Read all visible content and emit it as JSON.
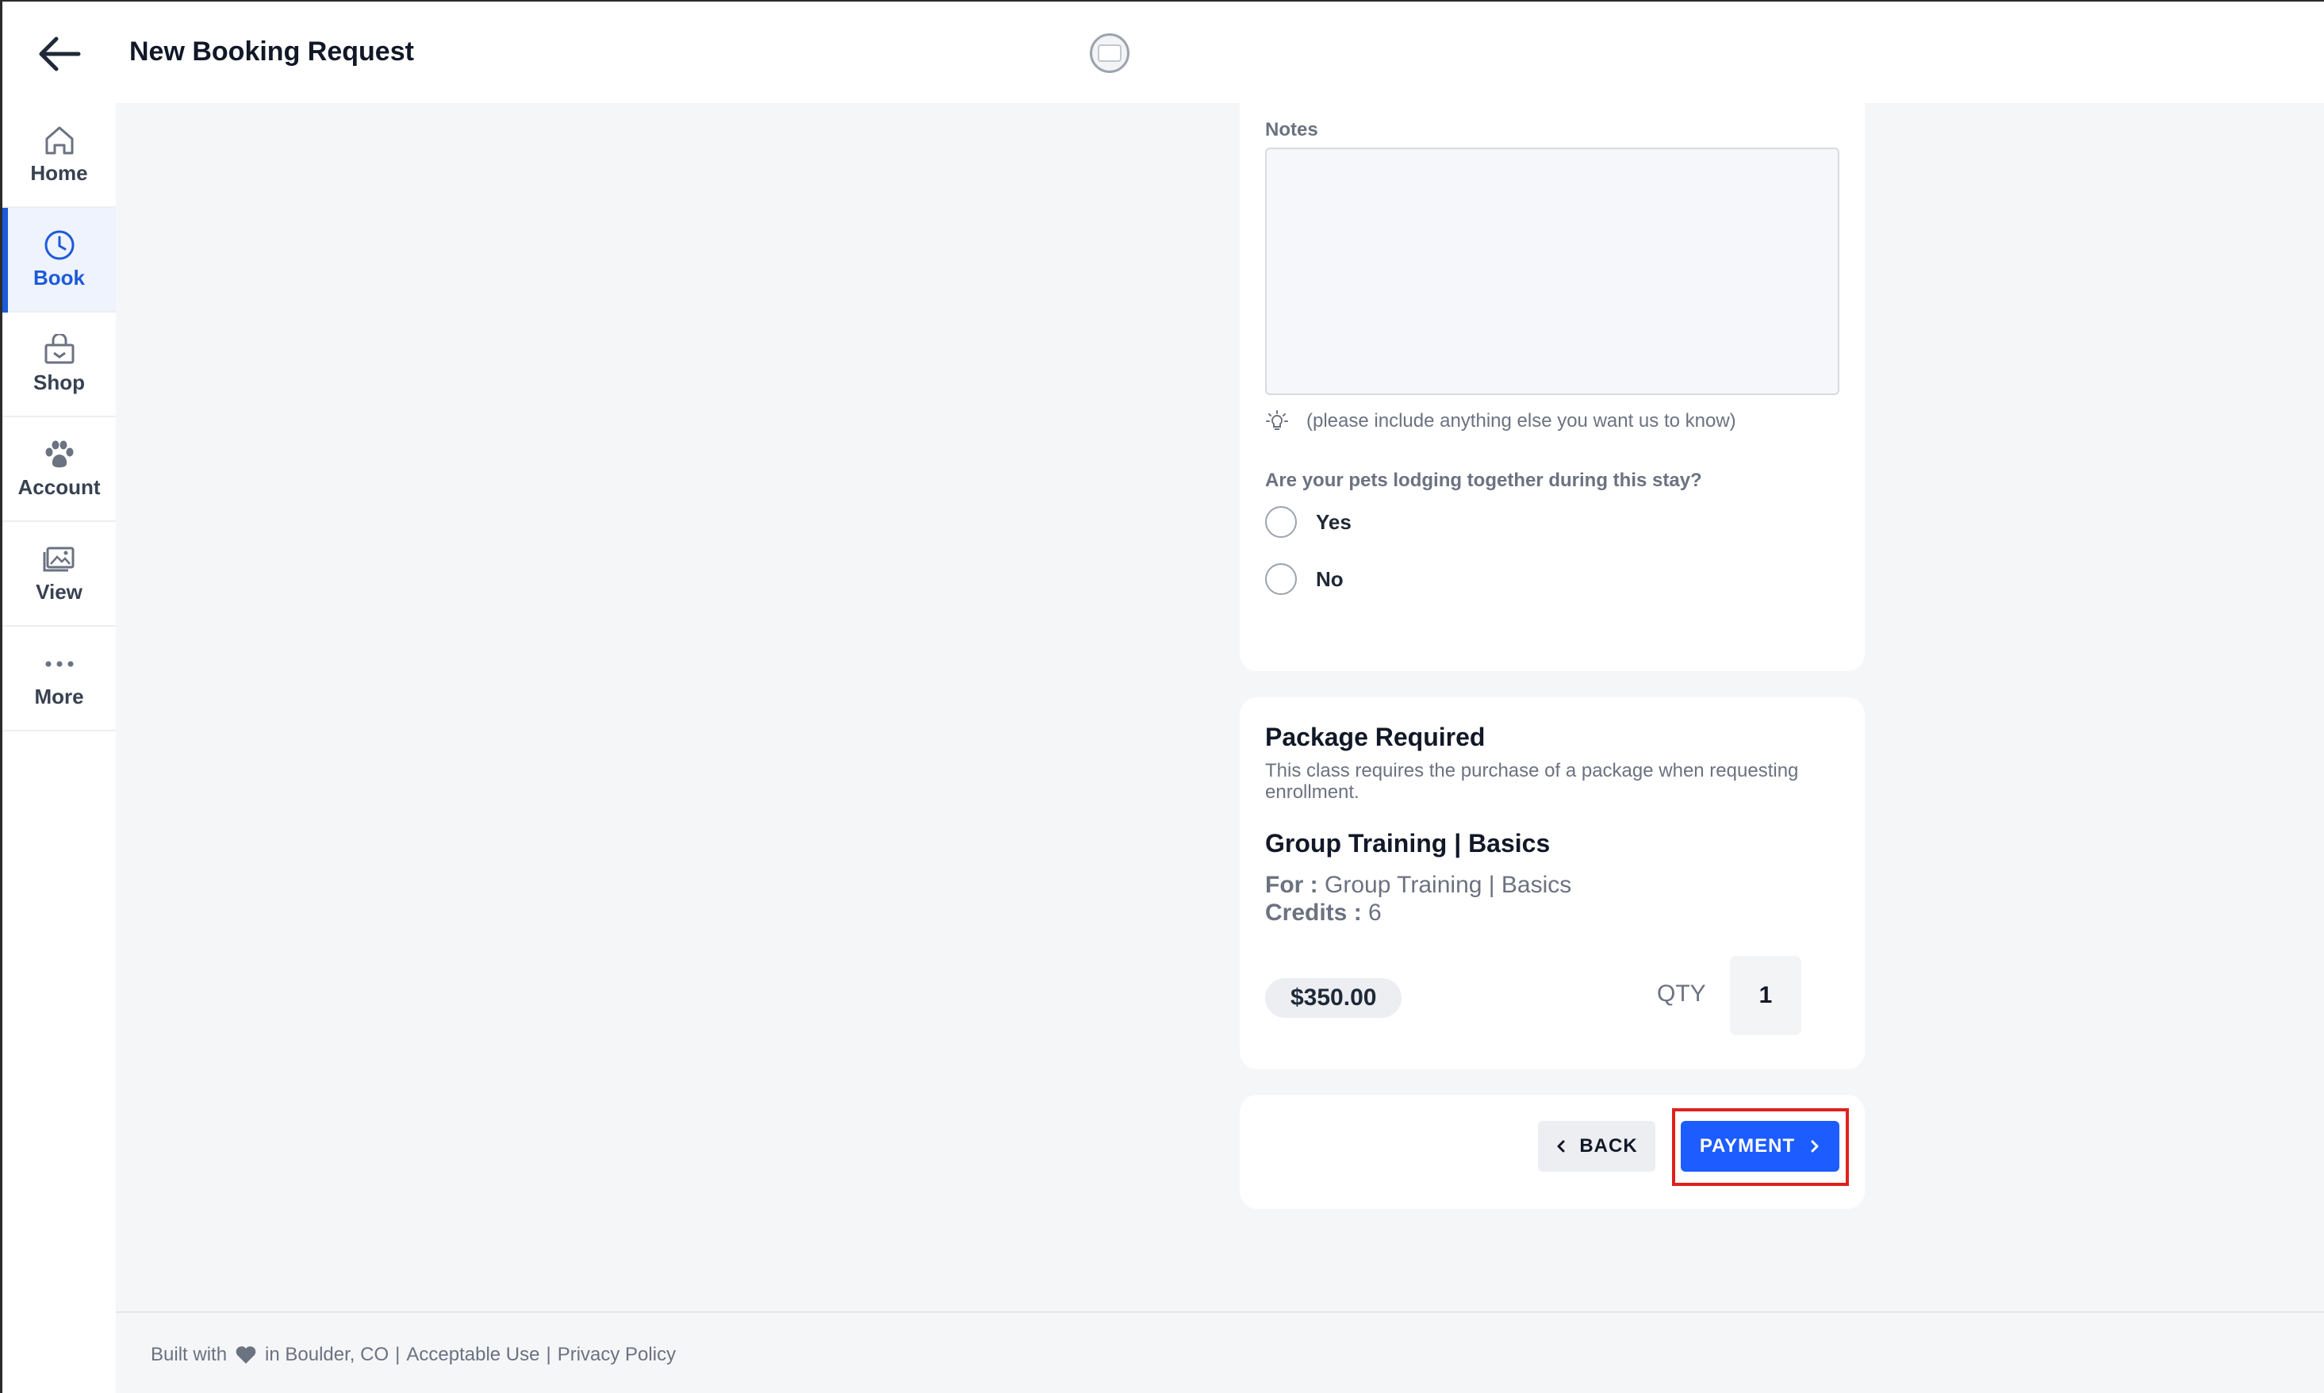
{
  "header": {
    "title": "New Booking Request"
  },
  "sidebar": {
    "items": [
      {
        "label": "Home",
        "icon": "home-icon"
      },
      {
        "label": "Book",
        "icon": "clock-icon",
        "active": true
      },
      {
        "label": "Shop",
        "icon": "shop-icon"
      },
      {
        "label": "Account",
        "icon": "paw-icon"
      },
      {
        "label": "View",
        "icon": "gallery-icon"
      },
      {
        "label": "More",
        "icon": "more-dots-icon"
      }
    ]
  },
  "form": {
    "notes_label": "Notes",
    "notes_value": "",
    "notes_hint": "(please include anything else you want us to know)",
    "lodging_question": "Are your pets lodging together during this stay?",
    "options": [
      "Yes",
      "No"
    ]
  },
  "package": {
    "title": "Package Required",
    "description": "This class requires the purchase of a package when requesting enrollment.",
    "item_name": "Group Training | Basics",
    "for_label": "For :",
    "for_value": "Group Training | Basics",
    "credits_label": "Credits :",
    "credits_value": "6",
    "price": "$350.00",
    "qty_label": "QTY",
    "qty_value": "1"
  },
  "actions": {
    "back_label": "BACK",
    "payment_label": "PAYMENT"
  },
  "footer": {
    "built_with": "Built with",
    "location": "in Boulder, CO",
    "acceptable_use": "Acceptable Use",
    "privacy_policy": "Privacy Policy",
    "separator": "|"
  },
  "colors": {
    "accent": "#1d5cff",
    "active_nav": "#1d5ad8",
    "highlight": "#e0201b"
  }
}
